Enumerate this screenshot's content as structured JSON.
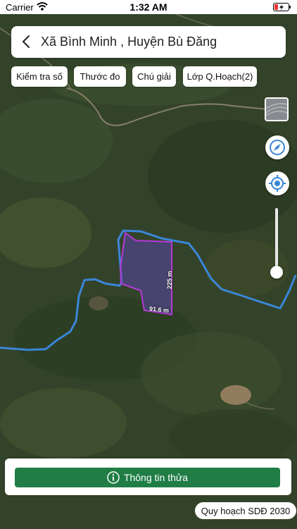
{
  "status_bar": {
    "carrier": "Carrier",
    "time": "1:32 AM"
  },
  "header": {
    "title": "Xã Bình Minh , Huyện Bù Đăng"
  },
  "toolbar": {
    "check_number": "Kiểm tra số",
    "ruler": "Thước đo",
    "legend": "Chú giải",
    "plan_layer": "Lớp Q.Hoạch(2)"
  },
  "parcel": {
    "side_right": "225 m",
    "side_bottom": "91.6 m"
  },
  "footer": {
    "info_button": "Thông tin thửa",
    "plan_badge": "Quy hoạch SDĐ 2030"
  },
  "colors": {
    "parcel_outline": "#b43ad6",
    "boundary_line": "#3a86d8",
    "primary_button": "#1f7d45"
  },
  "icons": [
    "back-icon",
    "layers-icon",
    "compass-icon",
    "locate-icon",
    "info-icon",
    "wifi-icon",
    "battery-icon"
  ]
}
